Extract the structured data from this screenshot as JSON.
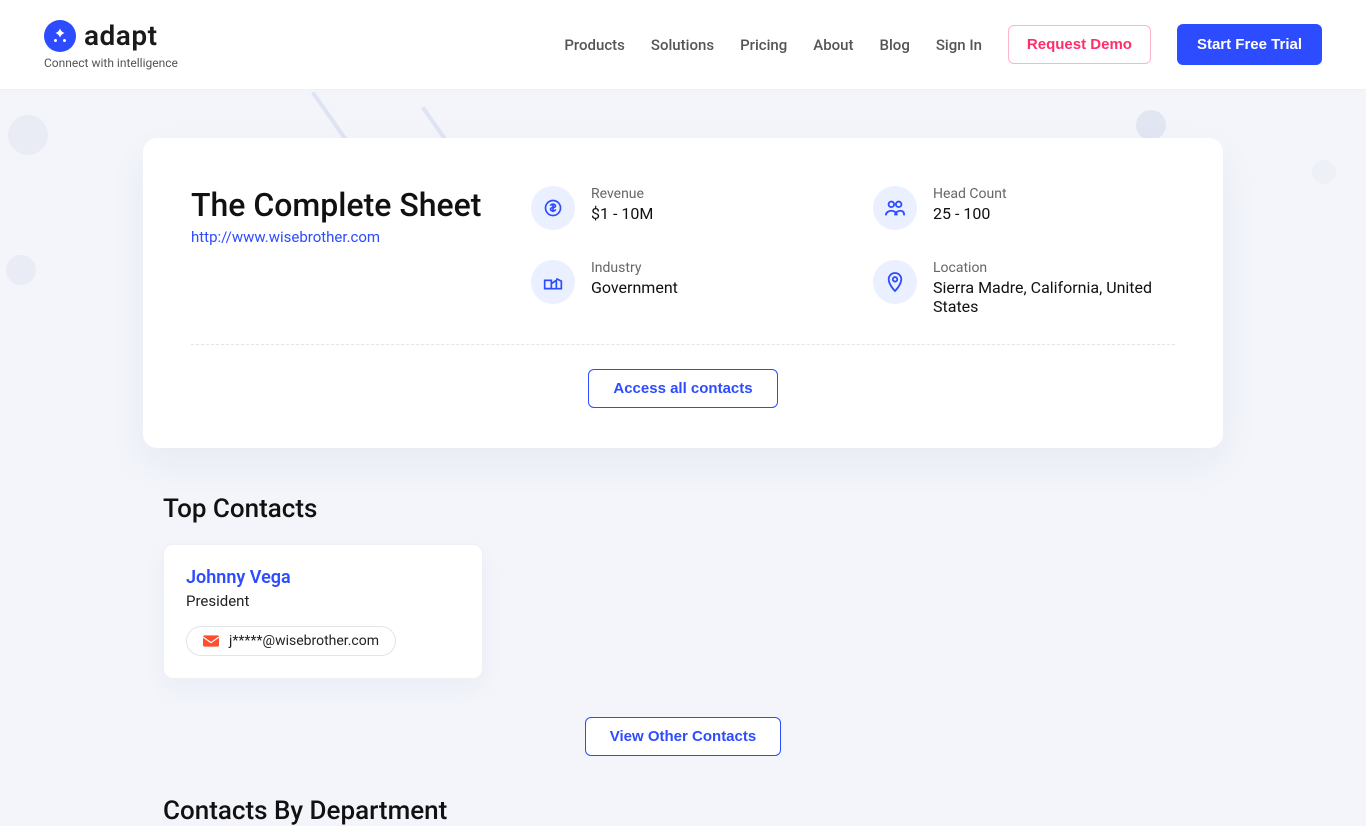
{
  "brand": {
    "name": "adapt",
    "tagline": "Connect with intelligence"
  },
  "nav": {
    "items": [
      "Products",
      "Solutions",
      "Pricing",
      "About",
      "Blog",
      "Sign In"
    ],
    "request_demo": "Request Demo",
    "start_trial": "Start Free Trial"
  },
  "company": {
    "name": "The Complete Sheet",
    "url": "http://www.wisebrother.com",
    "stats": {
      "revenue": {
        "label": "Revenue",
        "value": "$1 - 10M"
      },
      "headcount": {
        "label": "Head Count",
        "value": "25 - 100"
      },
      "industry": {
        "label": "Industry",
        "value": "Government"
      },
      "location": {
        "label": "Location",
        "value": "Sierra Madre, California, United States"
      }
    },
    "access_all_button": "Access all contacts"
  },
  "top_contacts": {
    "title": "Top Contacts",
    "items": [
      {
        "name": "Johnny Vega",
        "title": "President",
        "email": "j*****@wisebrother.com"
      }
    ],
    "view_other_button": "View Other Contacts"
  },
  "by_department": {
    "title": "Contacts By Department"
  }
}
